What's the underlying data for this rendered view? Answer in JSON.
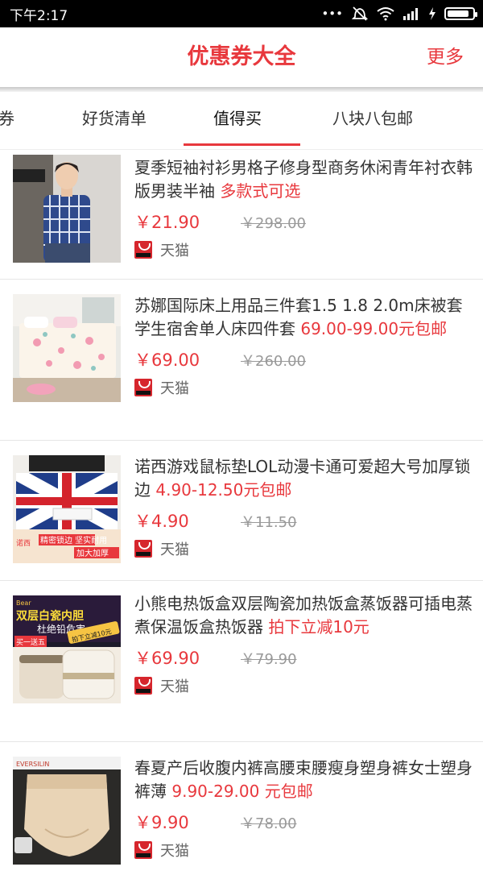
{
  "status_bar": {
    "time": "下午2:17",
    "icons": [
      "alarm-icon",
      "wifi-icon",
      "signal-icon",
      "battery-icon"
    ]
  },
  "header": {
    "title": "优惠券大全",
    "more": "更多"
  },
  "tabs": [
    {
      "label": "券"
    },
    {
      "label": "好货清单"
    },
    {
      "label": "值得买"
    },
    {
      "label": "八块八包邮"
    }
  ],
  "colors": {
    "accent": "#e8383d",
    "tmall": "#d6262d"
  },
  "products": [
    {
      "title": "夏季短袖衬衫男格子修身型商务休闲青年衬衣韩版男装半袖 ",
      "promo": "多款式可选",
      "price": "￥21.90",
      "original": "￥298.00",
      "shop": "天猫"
    },
    {
      "title": "苏娜国际床上用品三件套1.5 1.8 2.0m床被套学生宿舍单人床四件套 ",
      "promo": "69.00-99.00元包邮",
      "price": "￥69.00",
      "original": "￥260.00",
      "shop": "天猫"
    },
    {
      "title": "诺西游戏鼠标垫LOL动漫卡通可爱超大号加厚锁边 ",
      "promo": "4.90-12.50元包邮",
      "price": "￥4.90",
      "original": "￥11.50",
      "shop": "天猫",
      "image_text": {
        "brand": "诺西",
        "left": "精密锁边 坚实耐用",
        "right": "加大加厚"
      }
    },
    {
      "title": "小熊电热饭盒双层陶瓷加热饭盒蒸饭器可插电蒸煮保温饭盒热饭器 ",
      "promo": "拍下立减10元",
      "price": "￥69.90",
      "original": "￥79.90",
      "shop": "天猫",
      "image_text": {
        "brand": "Bear",
        "headline": "双层白瓷内胆",
        "sub": "杜绝铅危害",
        "corner": "拍下立减10元",
        "badge": "买一送五"
      }
    },
    {
      "title": "春夏产后收腹内裤高腰束腰瘦身塑身裤女士塑身裤薄 ",
      "promo": "9.90-29.00 元包邮",
      "price": "￥9.90",
      "original": "￥78.00",
      "shop": "天猫",
      "image_text": {
        "brand": "EVERSILIN"
      }
    }
  ]
}
